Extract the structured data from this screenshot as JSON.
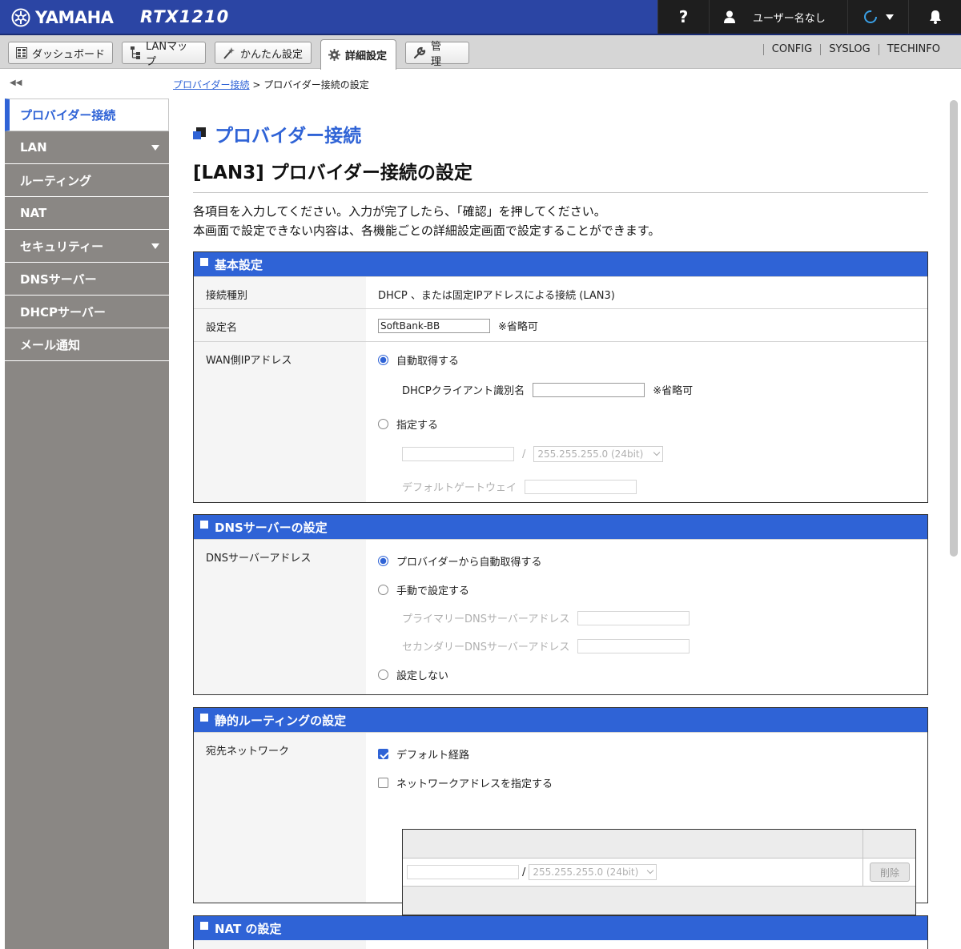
{
  "brand": {
    "logo": "YAMAHA",
    "product": "RTX1210"
  },
  "topbar": {
    "help": "?",
    "user": "ユーザー名なし"
  },
  "tabs": [
    {
      "label": "ダッシュボード"
    },
    {
      "label": "LANマップ"
    },
    {
      "label": "かんたん設定"
    },
    {
      "label": "詳細設定",
      "active": true
    },
    {
      "label": "管　理"
    }
  ],
  "top_links": [
    "CONFIG",
    "SYSLOG",
    "TECHINFO"
  ],
  "sidebar": {
    "collapse": "◀◀",
    "items": [
      {
        "label": "プロバイダー接続",
        "active": true
      },
      {
        "label": "LAN",
        "expand": true
      },
      {
        "label": "ルーティング"
      },
      {
        "label": "NAT"
      },
      {
        "label": "セキュリティー",
        "expand": true
      },
      {
        "label": "DNSサーバー"
      },
      {
        "label": "DHCPサーバー"
      },
      {
        "label": "メール通知"
      }
    ]
  },
  "breadcrumb": {
    "link": "プロバイダー接続",
    "sep": ">",
    "current": "プロバイダー接続の設定"
  },
  "page": {
    "title": "プロバイダー接続",
    "subtitle": "[LAN3] プロバイダー接続の設定",
    "instruction_1": "各項目を入力してください。入力が完了したら、「確認」を押してください。",
    "instruction_2": "本画面で設定できない内容は、各機能ごとの詳細設定画面で設定することができます。"
  },
  "basic": {
    "header": "基本設定",
    "conn_type_label": "接続種別",
    "conn_type_value": "DHCP 、または固定IPアドレスによる接続 (LAN3)",
    "name_label": "設定名",
    "name_value": "SoftBank-BB",
    "optional": "※省略可",
    "wan_label": "WAN側IPアドレス",
    "auto": "自動取得する",
    "dhcp_client_id": "DHCPクライアント識別名",
    "manual": "指定する",
    "slash": "/",
    "mask": "255.255.255.0 (24bit)",
    "gateway": "デフォルトゲートウェイ"
  },
  "dns": {
    "header": "DNSサーバーの設定",
    "label": "DNSサーバーアドレス",
    "auto": "プロバイダーから自動取得する",
    "manual": "手動で設定する",
    "primary": "プライマリーDNSサーバーアドレス",
    "secondary": "セカンダリーDNSサーバーアドレス",
    "none": "設定しない"
  },
  "routing": {
    "header": "静的ルーティングの設定",
    "label": "宛先ネットワーク",
    "default_route": "デフォルト経路",
    "specify": "ネットワークアドレスを指定する",
    "slash": "/",
    "mask": "255.255.255.0 (24bit)",
    "delete": "削除"
  },
  "nat": {
    "header": "NAT の設定"
  }
}
